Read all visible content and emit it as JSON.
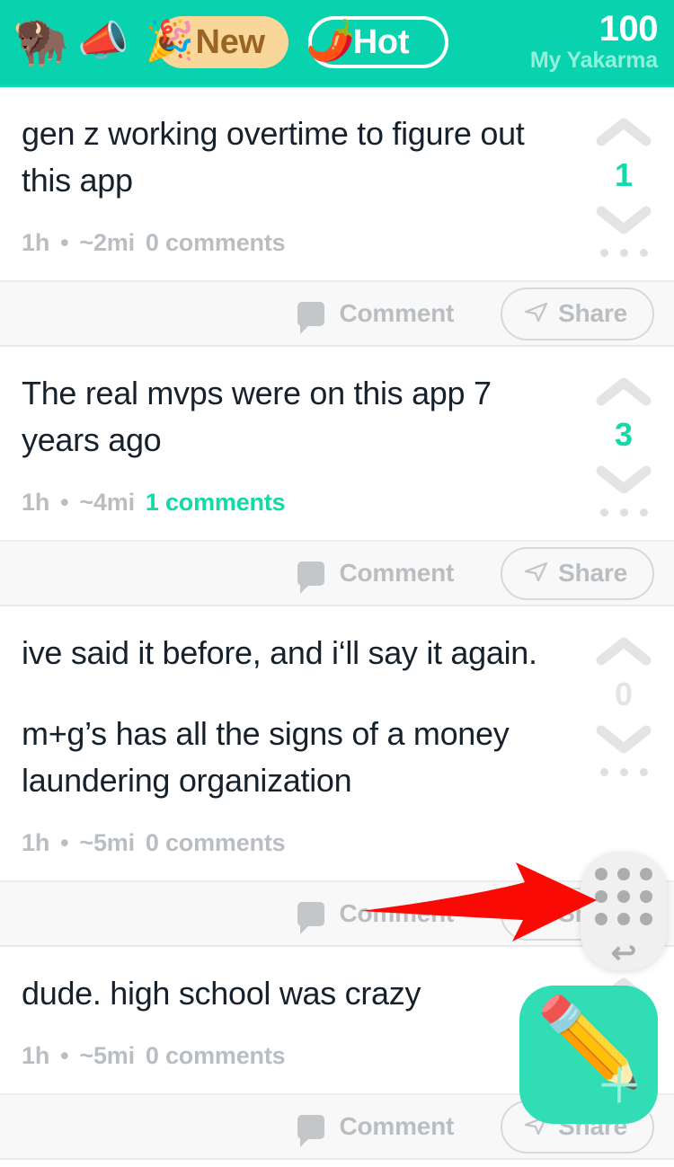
{
  "header": {
    "logo_icon": "yak-head-icon",
    "logo_emoji": "🦬",
    "megaphone_icon": "megaphone-icon",
    "megaphone_emoji": "📣",
    "tabs": [
      {
        "label": "New",
        "emoji": "🎉",
        "icon": "party-popper-icon",
        "active": true
      },
      {
        "label": "Hot",
        "emoji": "🌶️",
        "icon": "hot-pepper-icon",
        "active": false
      }
    ],
    "karma_value": "100",
    "karma_label": "My Yakarma",
    "bg_color": "#09D2AE",
    "active_tab_bg": "#F9D79B",
    "active_tab_text": "#9A6522",
    "karma_label_color": "#8FF0DC"
  },
  "actions": {
    "comment_label": "Comment",
    "share_label": "Share",
    "comment_icon": "speech-bubble-icon",
    "share_icon": "paper-plane-icon"
  },
  "vote": {
    "upvote_icon": "chevron-up-icon",
    "downvote_icon": "chevron-down-icon",
    "more_icon": "more-dots-icon"
  },
  "posts": [
    {
      "paragraphs": [
        "gen z working overtime to figure out this app"
      ],
      "time": "1h",
      "separator": "•",
      "distance": "~2mi",
      "comments": "0 comments",
      "comments_active": false,
      "score": "1",
      "score_positive": true
    },
    {
      "paragraphs": [
        "The real mvps were on this app 7 years ago"
      ],
      "time": "1h",
      "separator": "•",
      "distance": "~4mi",
      "comments": "1 comments",
      "comments_active": true,
      "score": "3",
      "score_positive": true
    },
    {
      "paragraphs": [
        "ive said it before, and i‘ll say it again.",
        "m+g’s has all the signs of a money laundering organization"
      ],
      "time": "1h",
      "separator": "•",
      "distance": "~5mi",
      "comments": "0 comments",
      "comments_active": false,
      "score": "0",
      "score_positive": false
    },
    {
      "paragraphs": [
        "dude. high school was crazy"
      ],
      "time": "1h",
      "separator": "•",
      "distance": "~5mi",
      "comments": "0 comments",
      "comments_active": false,
      "score": "",
      "score_positive": false
    }
  ],
  "compose": {
    "icon": "pencil-icon",
    "emoji": "✏️",
    "plus": "＋",
    "bg_color": "#31DDB4"
  },
  "floating_menu": {
    "grid_icon": "nine-dot-grid-icon",
    "back_icon": "back-arrow-icon",
    "back_glyph": "↩"
  },
  "annotation": {
    "arrow_icon": "red-pointer-arrow-icon",
    "color": "#FA0A05"
  }
}
